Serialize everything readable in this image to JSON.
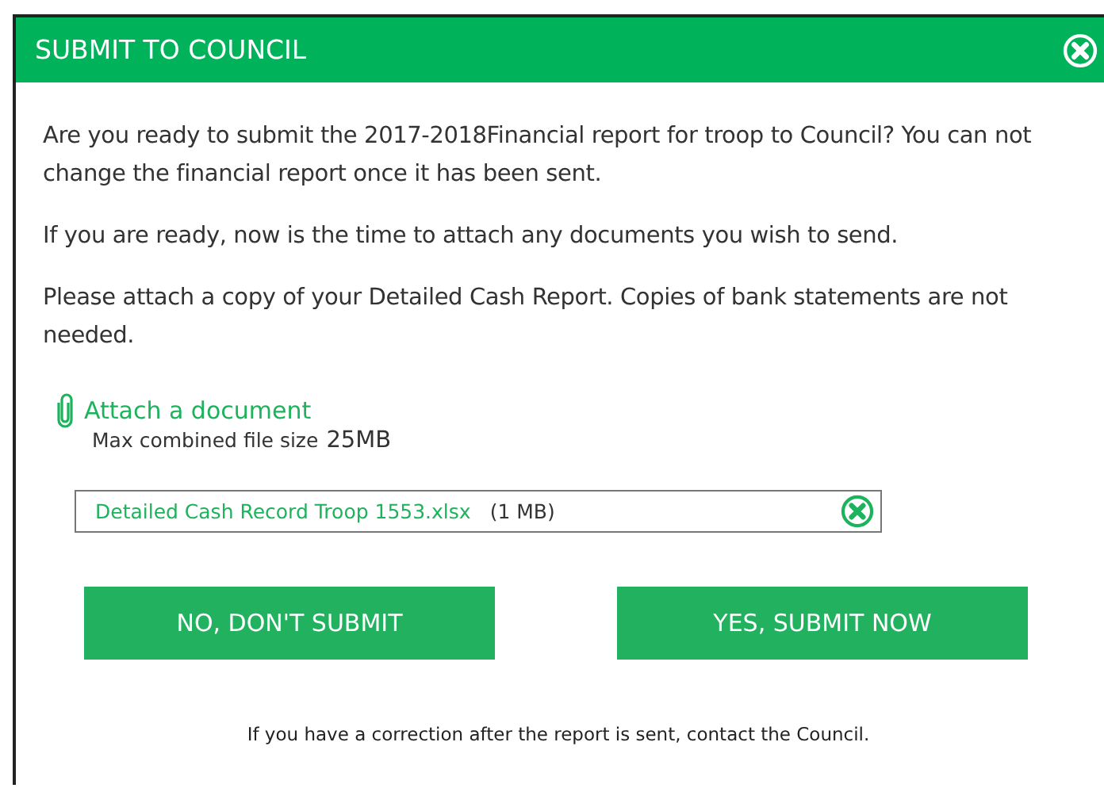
{
  "dialog": {
    "title": "SUBMIT TO COUNCIL"
  },
  "paragraphs": [
    "Are you ready to submit the 2017-2018Financial report for troop to Council? You can not change the financial report once it has been sent.",
    "If you are ready, now is the time to attach any documents you wish to send.",
    "Please attach a copy of your Detailed Cash Report. Copies of bank statements are not needed."
  ],
  "attach": {
    "label": "Attach a document",
    "limit_label": "Max combined file size",
    "limit_value": "25MB"
  },
  "files": [
    {
      "name": "Detailed Cash Record Troop 1553.xlsx",
      "size": "(1 MB)"
    }
  ],
  "buttons": [
    "NO, DON'T SUBMIT",
    "YES, SUBMIT NOW"
  ],
  "footer": "If you have a correction after the report is sent, contact the Council."
}
